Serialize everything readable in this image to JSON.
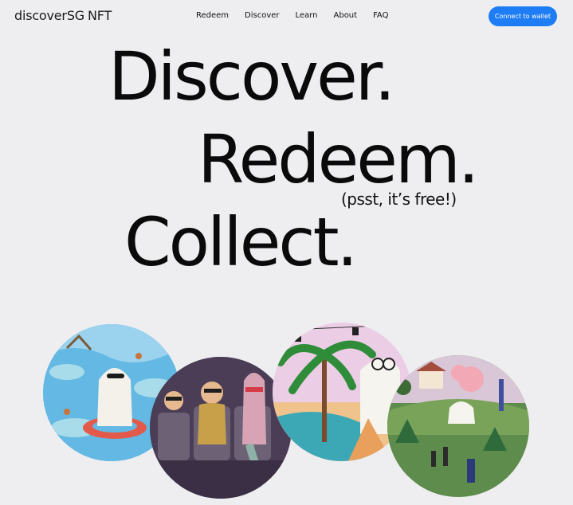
{
  "nav": {
    "logo_main": "discoverSG",
    "logo_suffix": "NFT",
    "links": [
      "Redeem",
      "Discover",
      "Learn",
      "About",
      "FAQ"
    ],
    "wallet_button": "Connect to wallet"
  },
  "hero": {
    "line1": "Discover.",
    "line2": "Redeem.",
    "aside": "(psst, it’s free!)",
    "line3": "Collect."
  },
  "colors": {
    "accent": "#1e7cf5",
    "background": "#eeeef0"
  }
}
